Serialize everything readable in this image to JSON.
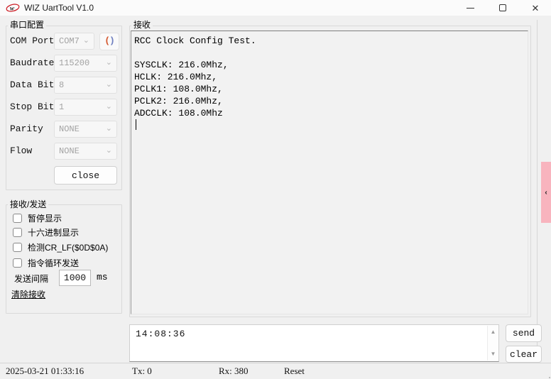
{
  "window": {
    "title": "WIZ UartTool V1.0",
    "close_glyph": "✕"
  },
  "icons": {
    "chevron_down": "⌄",
    "chevron_left": "‹",
    "refresh_left": "(",
    "refresh_right": ")",
    "arrow_up": "▲",
    "arrow_down": "▼",
    "logo_letter": "w"
  },
  "serial_config": {
    "title": "串口配置",
    "fields": [
      {
        "label": "COM Port",
        "value": "COM7"
      },
      {
        "label": "Baudrate",
        "value": "115200"
      },
      {
        "label": "Data Bit",
        "value": "8"
      },
      {
        "label": "Stop Bit",
        "value": "1"
      },
      {
        "label": "Parity",
        "value": "NONE"
      },
      {
        "label": "Flow",
        "value": "NONE"
      }
    ],
    "close_button": "close"
  },
  "rx_tx_panel": {
    "title": "接收/发送",
    "checkboxes": [
      {
        "label": "暂停显示",
        "checked": false
      },
      {
        "label": "十六进制显示",
        "checked": false
      },
      {
        "label": "检测CR_LF($0D$0A)",
        "checked": false
      },
      {
        "label": "指令循环发送",
        "checked": false
      }
    ],
    "interval_label": "发送间隔",
    "interval_value": "1000",
    "interval_unit": "ms",
    "clear_link": "清除接收"
  },
  "receive_panel": {
    "title": "接收",
    "lines": [
      "RCC Clock Config Test.",
      "",
      "SYSCLK: 216.0Mhz,",
      "HCLK: 216.0Mhz,",
      "PCLK1: 108.0Mhz,",
      "PCLK2: 216.0Mhz,",
      "ADCCLK: 108.0Mhz"
    ]
  },
  "send_panel": {
    "input_value": "14:08:36",
    "send_button": "send",
    "clear_button": "clear"
  },
  "status_bar": {
    "timestamp": "2025-03-21 01:33:16",
    "tx": "Tx: 0",
    "rx": "Rx: 380",
    "reset": "Reset"
  },
  "colors": {
    "window_bg": "#f0f0f0",
    "titlebar_bg": "#fbfbfb",
    "side_tab_pink": "#f8b4be",
    "logo_red": "#cc1a22",
    "refresh_orange": "#d4572e",
    "refresh_blue": "#6f7fc0",
    "disabled_text": "#a3a3a3"
  }
}
